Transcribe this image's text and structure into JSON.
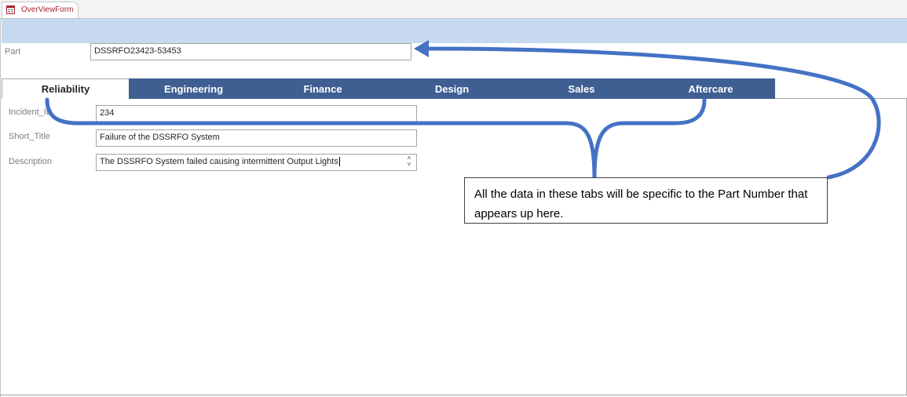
{
  "document_tab": {
    "label": "OverViewForm",
    "icon": "form-icon"
  },
  "colors": {
    "header_band": "#c6d9f1",
    "tab_fill": "#3f5f93",
    "annotation_stroke": "#4472c4",
    "doc_tab_text": "#a4262c"
  },
  "form": {
    "part_label": "Part",
    "part_value": "DSSRFO23423-53453"
  },
  "tabs": [
    {
      "label": "Reliability",
      "active": true
    },
    {
      "label": "Engineering",
      "active": false
    },
    {
      "label": "Finance",
      "active": false
    },
    {
      "label": "Design",
      "active": false
    },
    {
      "label": "Sales",
      "active": false
    },
    {
      "label": "Aftercare",
      "active": false
    }
  ],
  "reliability_page": {
    "incident_label": "Incident_ID",
    "incident_value": "234",
    "short_title_label": "Short_Title",
    "short_title_value": "Failure of the DSSRFO System",
    "description_label": "Description",
    "description_value": "The DSSRFO System failed causing intermittent Output Lights"
  },
  "annotation": {
    "callout_text": "All the data in these tabs will be specific to the Part Number that appears up here."
  }
}
